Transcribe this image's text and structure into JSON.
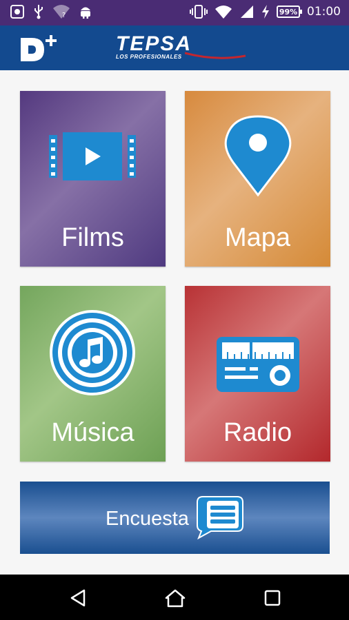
{
  "status_bar": {
    "battery": "99%",
    "time": "01:00",
    "icons": [
      "screenshot-icon",
      "usb-icon",
      "wifi-question-icon",
      "android-icon",
      "vibrate-icon",
      "wifi-icon",
      "signal-icon",
      "charging-icon",
      "battery-icon"
    ]
  },
  "header": {
    "logo": "D+",
    "brand": "TEPSA",
    "brand_tagline": "LOS PROFESIONALES"
  },
  "tiles": [
    {
      "label": "Films",
      "icon": "film-play-icon",
      "color": "#6b5592"
    },
    {
      "label": "Mapa",
      "icon": "map-pin-icon",
      "color": "#dea05f"
    },
    {
      "label": "Música",
      "icon": "music-note-icon",
      "color": "#8ab672"
    },
    {
      "label": "Radio",
      "icon": "radio-icon",
      "color": "#c85557"
    }
  ],
  "survey": {
    "label": "Encuesta",
    "icon": "chat-list-icon",
    "color": "#2a5c9c"
  },
  "nav": {
    "icons": [
      "back-icon",
      "home-icon",
      "recents-icon"
    ]
  },
  "colors": {
    "status_bar": "#4a2c74",
    "header": "#134a8f",
    "icon_blue": "#1e8ad0"
  }
}
